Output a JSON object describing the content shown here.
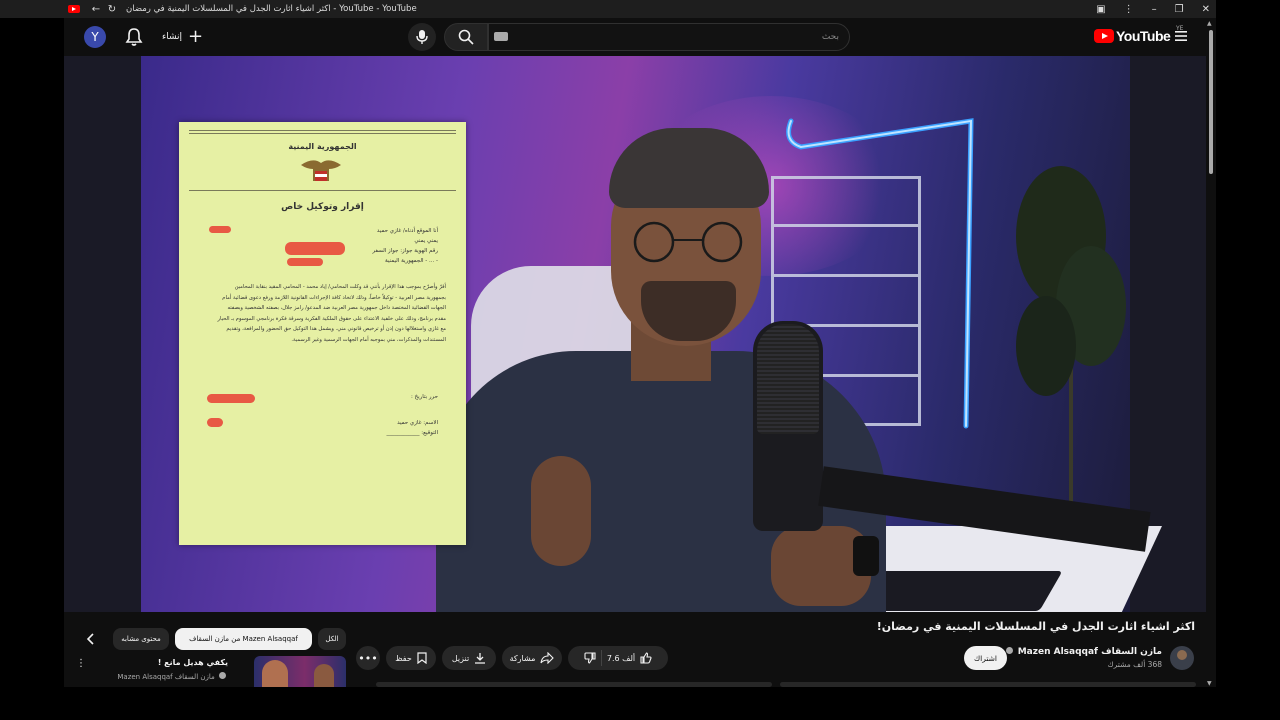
{
  "window": {
    "title": "اكثر اشياء اثارت الجدل في المسلسلات اليمنية في رمضان - YouTube - YouTube",
    "icons": [
      "youtube-favicon",
      "back-icon",
      "reload-icon",
      "extensions-icon",
      "more-vert-icon",
      "minimize-icon",
      "restore-icon",
      "close-icon"
    ]
  },
  "topbar": {
    "avatar_letter": "Y",
    "create_label": "إنشاء",
    "search_placeholder": "بحث",
    "logo_text": "YouTube",
    "country_code": "YE"
  },
  "video": {
    "document": {
      "republic": "الجمهورية اليمنية",
      "heading": "إقرار وتوكيل خاص",
      "lines": [
        "أنا الموقع أدناه/ غازي حميد",
        "يمني يمني",
        "رقم الهوية جواز: جواز السفر",
        "- ... - الجمهورية اليمنية"
      ],
      "paragraph": "أقرّ وأصرّح بموجب هذا الإقرار بأنني قد وكلت المحامي/ إياد محمد - المحامي المقيد بنقابة المحامين بجمهورية مصر العربية - توكيلاً خاصاً، وذلك لاتخاذ كافة الإجراءات القانونية اللازمة ورفع دعوى قضائية أمام الجهات القضائية المختصة داخل جمهورية مصر العربية ضد المدعو/ رامز جلال، بصفته الشخصية وبصفته مقدم برنامج، وذلك على خلفية الاعتداء على حقوق الملكية الفكرية وسرقة فكرة برنامجي الموسوم بـ الحيار مع غازي واستغلالها دون إذن أو ترخيص قانوني مني. ويشمل هذا التوكيل حق الحضور والمرافعة، وتقديم المستندات والمذكرات، مني بموجبه أمام الجهات الرسمية وغير الرسمية.",
      "date_label": "حرر بتاريخ :",
      "name_label": "الاسم: غازي حميد",
      "signature_label": "التوقيع: ____________"
    }
  },
  "info": {
    "title": "اكثر اشياء اثارت الجدل في المسلسلات اليمنية في رمضان!",
    "channel_name": "مازن السقاف Mazen Alsaqqaf",
    "subscribers": "368 ألف مشترك",
    "subscribe_label": "اشتراك",
    "likes": "7.6 ألف",
    "share_label": "مشاركة",
    "download_label": "تنزيل",
    "save_label": "حفظ",
    "more_label": "•••"
  },
  "suggestions": {
    "chips": [
      "الكل",
      "من مازن السقاف Mazen Alsaqqaf",
      "محتوى مشابه"
    ],
    "active_chip": 1,
    "rec": {
      "title": "يكفي هديل مانع !",
      "channel": "مازن السقاف Mazen Alsaqqaf"
    }
  },
  "colors": {
    "background": "#0f0f0f",
    "accent_red": "#ff0000",
    "pill": "#272727",
    "document_paper": "#e6f0a4",
    "redaction": "#e8483a",
    "neon": "#3aa0ff"
  }
}
